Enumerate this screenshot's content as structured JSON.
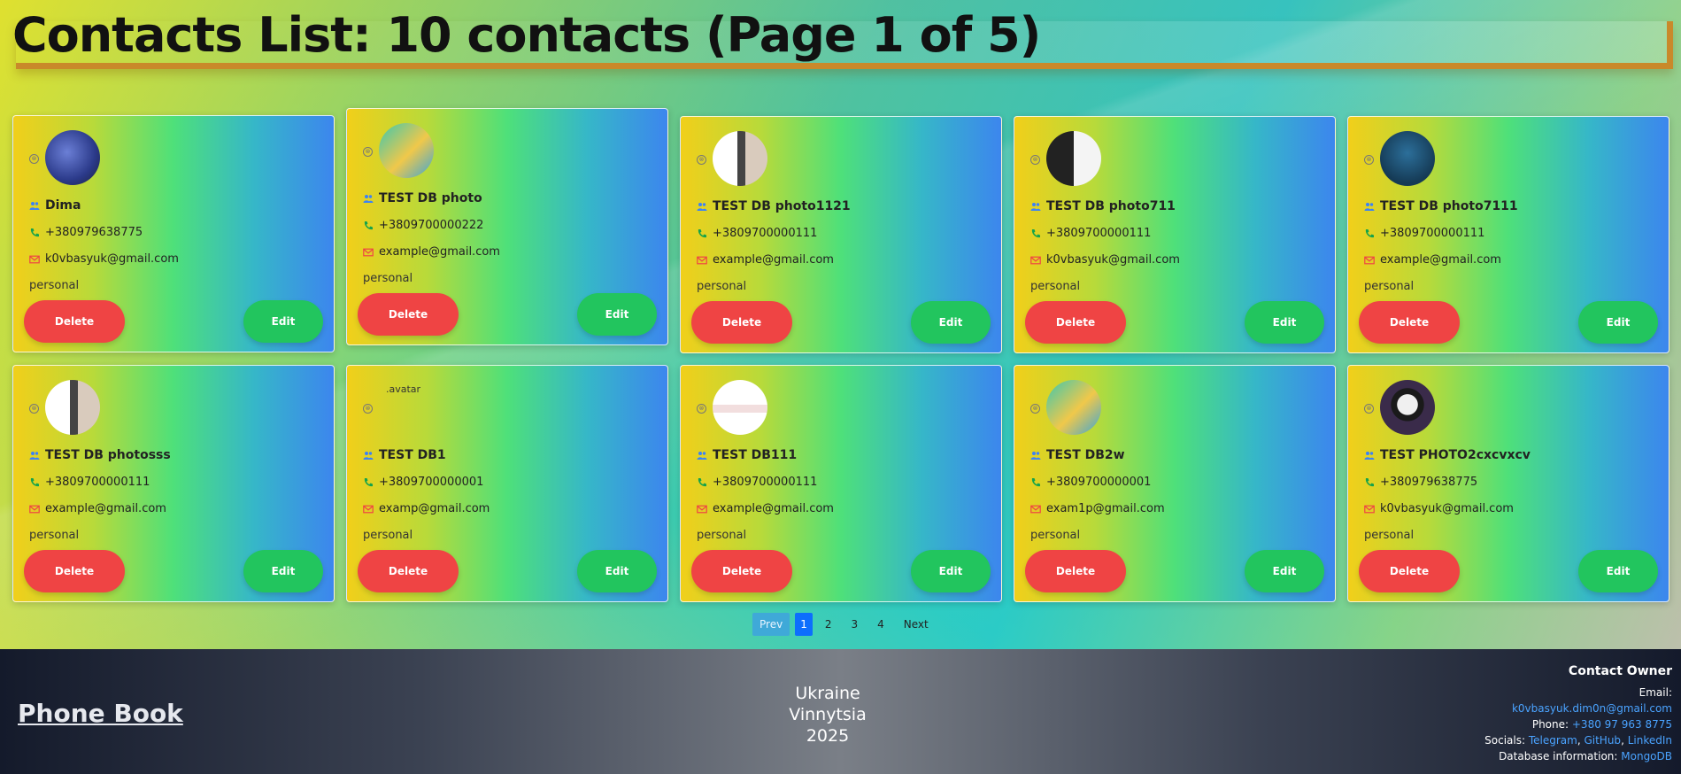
{
  "page": {
    "title": "Contacts List: 10 contacts (Page 1 of 5)"
  },
  "colors": {
    "delete": "#ef4444",
    "edit": "#22c55e",
    "active_page": "#0d6efd",
    "title_underline": "#c9892a",
    "link": "#4aa3ff"
  },
  "contacts": [
    {
      "name": "Dima",
      "phone": "+380979638775",
      "email": "k0vbasyuk@gmail.com",
      "category": "personal",
      "avatar": "photo-avatar",
      "delete_label": "Delete",
      "edit_label": "Edit"
    },
    {
      "name": "TEST DB photo",
      "phone": "+3809700000222",
      "email": "example@gmail.com",
      "category": "personal",
      "avatar": "photo-avatar",
      "delete_label": "Delete",
      "edit_label": "Edit"
    },
    {
      "name": "TEST DB photo1121",
      "phone": "+3809700000111",
      "email": "example@gmail.com",
      "category": "personal",
      "avatar": "photo-avatar",
      "delete_label": "Delete",
      "edit_label": "Edit"
    },
    {
      "name": "TEST DB photo711",
      "phone": "+3809700000111",
      "email": "k0vbasyuk@gmail.com",
      "category": "personal",
      "avatar": "photo-avatar",
      "delete_label": "Delete",
      "edit_label": "Edit"
    },
    {
      "name": "TEST DB photo7111",
      "phone": "+3809700000111",
      "email": "example@gmail.com",
      "category": "personal",
      "avatar": "photo-avatar",
      "delete_label": "Delete",
      "edit_label": "Edit"
    },
    {
      "name": "TEST DB photosss",
      "phone": "+3809700000111",
      "email": "example@gmail.com",
      "category": "personal",
      "avatar": "photo-avatar",
      "delete_label": "Delete",
      "edit_label": "Edit"
    },
    {
      "name": "TEST DB1",
      "phone": "+3809700000001",
      "email": "examp@gmail.com",
      "category": "personal",
      "avatar": "broken-image",
      "avatar_alt": ".avatar",
      "delete_label": "Delete",
      "edit_label": "Edit"
    },
    {
      "name": "TEST DB111",
      "phone": "+3809700000111",
      "email": "example@gmail.com",
      "category": "personal",
      "avatar": "photo-avatar",
      "delete_label": "Delete",
      "edit_label": "Edit"
    },
    {
      "name": "TEST DB2w",
      "phone": "+3809700000001",
      "email": "exam1p@gmail.com",
      "category": "personal",
      "avatar": "photo-avatar",
      "delete_label": "Delete",
      "edit_label": "Edit"
    },
    {
      "name": "TEST PHOTO2cxcvxcv",
      "phone": "+380979638775",
      "email": "k0vbasyuk@gmail.com",
      "category": "personal",
      "avatar": "photo-avatar",
      "delete_label": "Delete",
      "edit_label": "Edit"
    }
  ],
  "pagination": {
    "prev": "Prev",
    "pages": [
      "1",
      "2",
      "3",
      "4"
    ],
    "active": "1",
    "next": "Next"
  },
  "footer": {
    "brand": "Phone Book",
    "country": "Ukraine",
    "city": "Vinnytsia",
    "year": "2025",
    "owner_heading": "Contact Owner",
    "email_label": "Email:",
    "email": "k0vbasyuk.dim0n@gmail.com",
    "phone_label": "Phone:",
    "phone": "+380 97 963 8775",
    "socials_label": "Socials:",
    "socials": [
      "Telegram",
      "GitHub",
      "LinkedIn"
    ],
    "db_label": "Database information:",
    "db": "MongoDB"
  }
}
